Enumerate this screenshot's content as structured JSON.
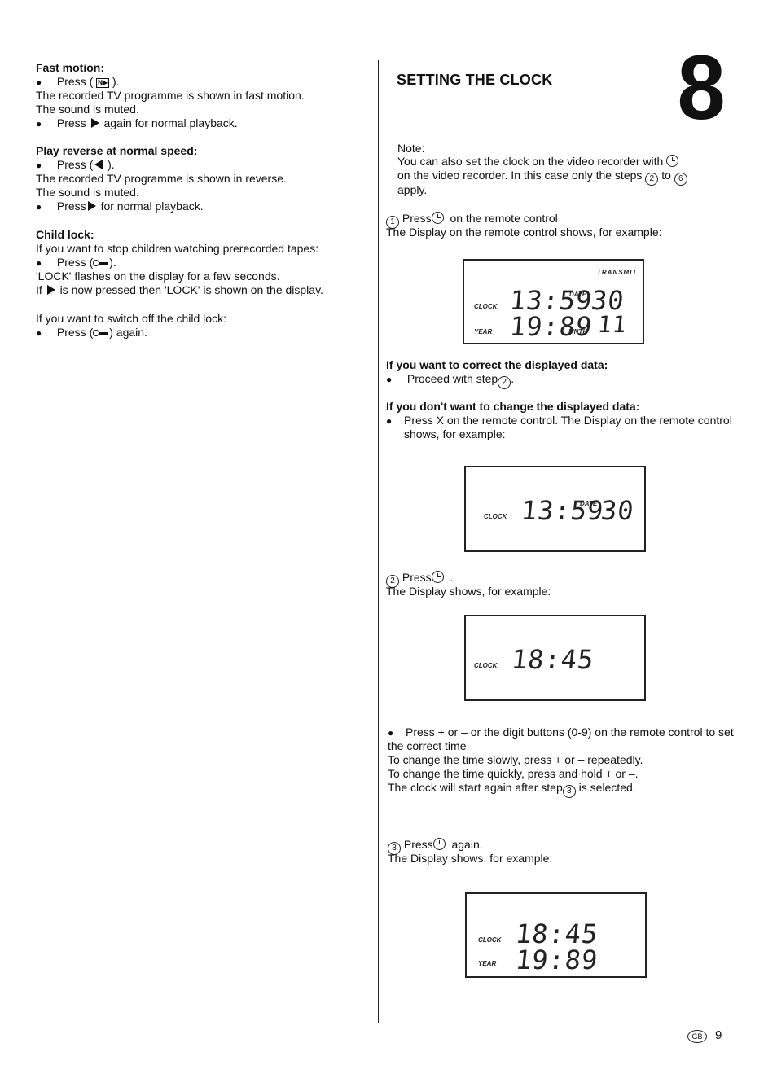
{
  "left_column": {
    "fast_motion": {
      "heading": "Fast motion:",
      "step1_prefix": "Press (",
      "step1_suffix": ").",
      "step1_icon": "fast-forward-button-icon",
      "line1": "The recorded TV programme is shown in fast motion.",
      "line2": "The sound is muted.",
      "step2_prefix": "Press",
      "step2_suffix": "again for normal playback."
    },
    "play_reverse": {
      "heading": "Play reverse at normal speed:",
      "step1_prefix": "Press (",
      "step1_suffix": ").",
      "line1": "The recorded TV programme is shown in reverse.",
      "line2": "The sound is muted.",
      "step2_prefix": "Press",
      "step2_suffix": "for normal playback."
    },
    "child_lock": {
      "heading": "Child lock:",
      "intro": "If you want to stop children watching prerecorded tapes:",
      "step1_prefix": "Press (",
      "step1_suffix": ").",
      "line1": "'LOCK' flashes on the display for a few seconds.",
      "line2_prefix": "If",
      "line2_suffix": "is now pressed then 'LOCK' is shown on the display.",
      "switch_off_intro": "If you want to switch off the child lock:",
      "step2_prefix": "Press (",
      "step2_suffix": ") again."
    }
  },
  "right_column": {
    "title": "SETTING THE CLOCK",
    "chapter_number": "8",
    "note": {
      "label": "Note:",
      "line1": "You can also set the clock on the video recorder with",
      "line2_prefix": "on the video recorder. In this case only the steps",
      "step_from": "2",
      "to_word": "to",
      "step_to": "6",
      "line3": "apply."
    },
    "step1": {
      "number": "1",
      "text_prefix": "Press",
      "text_suffix": "on the remote control",
      "line2": "The Display on the remote control shows, for example:"
    },
    "display1": {
      "transmit_label": "TRANSMIT",
      "clock_label": "CLOCK",
      "clock_value": "13:59",
      "date_label": "DATE",
      "date_value": "30",
      "year_label": "YEAR",
      "year_value": "19:89",
      "month_label": "MNTH",
      "month_value": "11"
    },
    "correct_heading": "If you want to correct the displayed data:",
    "correct_bullet_prefix": "Proceed with step",
    "correct_bullet_step": "2",
    "nochange_heading": "If you don't want to change the displayed data:",
    "nochange_bullet_line1": "Press X on the remote control. The Display on the remote control",
    "nochange_bullet_line2": "shows, for example:",
    "display2": {
      "clock_label": "CLOCK",
      "clock_value": "13:59",
      "date_label": "DATE",
      "date_value": "30"
    },
    "step2": {
      "number": "2",
      "text_prefix": "Press",
      "text_suffix": ".",
      "line2": "The Display shows, for example:"
    },
    "display3": {
      "clock_label": "CLOCK",
      "clock_value": "18:45"
    },
    "instructions": {
      "bullet_line1": "Press + or – or the digit buttons (0-9) on the remote control to set",
      "bullet_line2": "the correct time",
      "line3": "To change the time slowly, press + or – repeatedly.",
      "line4": "To change the time quickly, press and hold + or –.",
      "line5_prefix": "The clock will start again after step",
      "line5_step": "3",
      "line5_suffix": "is selected."
    },
    "step3": {
      "number": "3",
      "text_prefix": "Press",
      "text_suffix": "again.",
      "line2": "The Display shows, for example:"
    },
    "display4": {
      "clock_label": "CLOCK",
      "clock_value": "18:45",
      "year_label": "YEAR",
      "year_value": "19:89"
    }
  },
  "footer": {
    "country_badge": "GB",
    "page_number": "9"
  }
}
